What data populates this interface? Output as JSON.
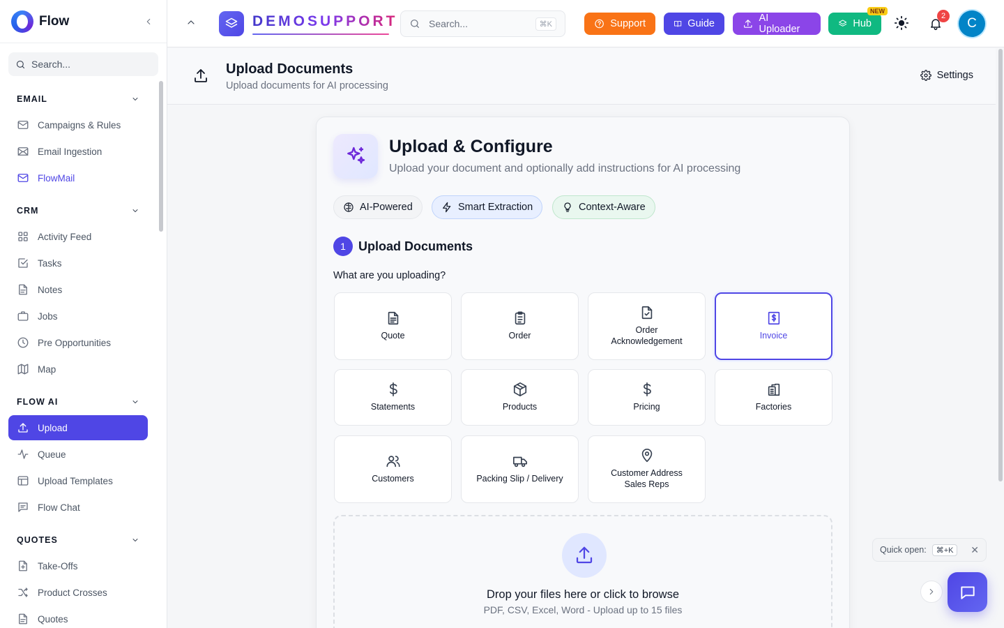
{
  "sidebar": {
    "brand": "Flow",
    "search_placeholder": "Search...",
    "sections": [
      {
        "title": "EMAIL",
        "items": [
          "Campaigns & Rules",
          "Email Ingestion",
          "FlowMail"
        ]
      },
      {
        "title": "CRM",
        "items": [
          "Activity Feed",
          "Tasks",
          "Notes",
          "Jobs",
          "Pre Opportunities",
          "Map"
        ]
      },
      {
        "title": "FLOW AI",
        "items": [
          "Upload",
          "Queue",
          "Upload Templates",
          "Flow Chat"
        ]
      },
      {
        "title": "QUOTES",
        "items": [
          "Take-Offs",
          "Product Crosses",
          "Quotes"
        ]
      }
    ]
  },
  "topbar": {
    "brand_text": "DEMOSUPPORT",
    "search_placeholder": "Search...",
    "search_shortcut": "⌘K",
    "buttons": {
      "support": "Support",
      "guide": "Guide",
      "ai_uploader": "AI Uploader",
      "hub": "Hub"
    },
    "hub_badge": "NEW",
    "notification_count": "2",
    "avatar_initial": "C"
  },
  "page": {
    "title": "Upload Documents",
    "subtitle": "Upload documents for AI processing",
    "settings_label": "Settings"
  },
  "card": {
    "title": "Upload & Configure",
    "subtitle": "Upload your document and optionally add instructions for AI processing",
    "tags": [
      "AI-Powered",
      "Smart Extraction",
      "Context-Aware"
    ],
    "step_number": "1",
    "step_title": "Upload Documents",
    "question": "What are you uploading?",
    "options": [
      "Quote",
      "Order",
      "Order Acknowledgement",
      "Invoice",
      "Statements",
      "Products",
      "Pricing",
      "Factories",
      "Customers",
      "Packing Slip / Delivery",
      "Customer Address Sales Reps"
    ],
    "selected_option": "Invoice",
    "dropzone_title": "Drop your files here or click to browse",
    "dropzone_subtitle": "PDF, CSV, Excel, Word - Upload up to 15 files"
  },
  "floating": {
    "quick_open_label": "Quick open:",
    "quick_open_shortcut": "⌘+K"
  },
  "colors": {
    "accent": "#4f46e5",
    "support": "#f97316",
    "ai_uploader": "#8b45e8",
    "hub": "#10b981",
    "badge": "#ef4444"
  }
}
